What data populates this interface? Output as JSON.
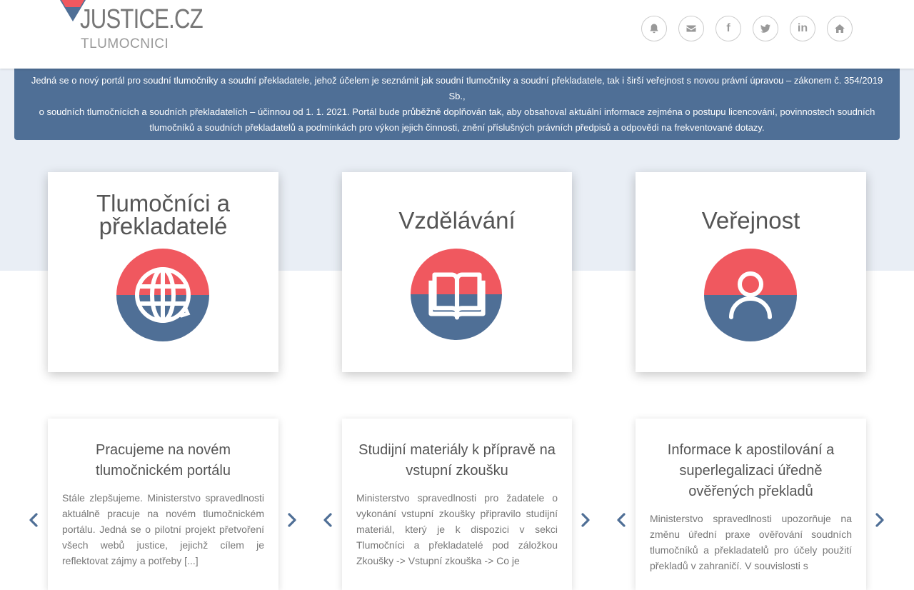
{
  "logo": {
    "title": "JUSTICE.CZ",
    "subtitle": "TLUMOCNICI"
  },
  "social_icons": [
    {
      "name": "bell-icon"
    },
    {
      "name": "envelope-icon"
    },
    {
      "name": "facebook-icon",
      "glyph": "f"
    },
    {
      "name": "twitter-icon"
    },
    {
      "name": "linkedin-icon",
      "glyph": "in"
    },
    {
      "name": "home-icon"
    }
  ],
  "banner": {
    "line1": "Jedná se o nový portál pro soudní tlumočníky a soudní překladatele, jehož účelem je seznámit jak soudní tlumočníky a soudní překladatele, tak i širší veřejnost s novou právní úpravou – zákonem č. 354/2019 Sb.,",
    "line2": "o soudních tlumočnících a soudních překladatelích – účinnou od 1. 1. 2021. Portál bude průběžně doplňován tak, aby obsahoval aktuální informace zejména o postupu licencování, povinnostech soudních tlumočníků a soudních překladatelů a podmínkách pro výkon jejich činnosti, znění příslušných právních předpisů a odpovědi na frekventované dotazy."
  },
  "categories": [
    {
      "title_line1": "Tlumočníci a",
      "title_line2": "překladatelé",
      "icon": "globe-icon"
    },
    {
      "title_line1": "Vzdělávání",
      "icon": "book-icon"
    },
    {
      "title_line1": "Veřejnost",
      "icon": "person-icon"
    }
  ],
  "news": [
    {
      "title": "Pracujeme na novém tlumočnickém portálu",
      "text": "Stále zlepšujeme. Ministerstvo spravedlnosti aktuálně pracuje na novém tlumočnickém portálu. Jedná se o pilotní projekt přetvoření všech webů justice, jejichž cílem je reflektovat zájmy a potřeby [...]"
    },
    {
      "title": "Studijní materiály k přípravě na vstupní zkoušku",
      "text": "Ministerstvo spravedlnosti pro žadatele o vykonání vstupní zkoušky připravilo studijní materiál, který je k dispozici v sekci Tlumočníci a překladatelé pod záložkou Zkoušky -> Vstupní zkouška -> Co je"
    },
    {
      "title": "Informace k apostilování a superlegalizaci úředně ověřených překladů",
      "text": "Ministerstvo spravedlnosti upozorňuje na změnu úřední praxe ověřování soudních tlumočníků a překladatelů pro účely použití překladů v zahraničí. V souvislosti s"
    }
  ],
  "colors": {
    "accent_red": "#f0585f",
    "accent_blue": "#4f6f96",
    "hero_bg": "#e9eef5"
  }
}
